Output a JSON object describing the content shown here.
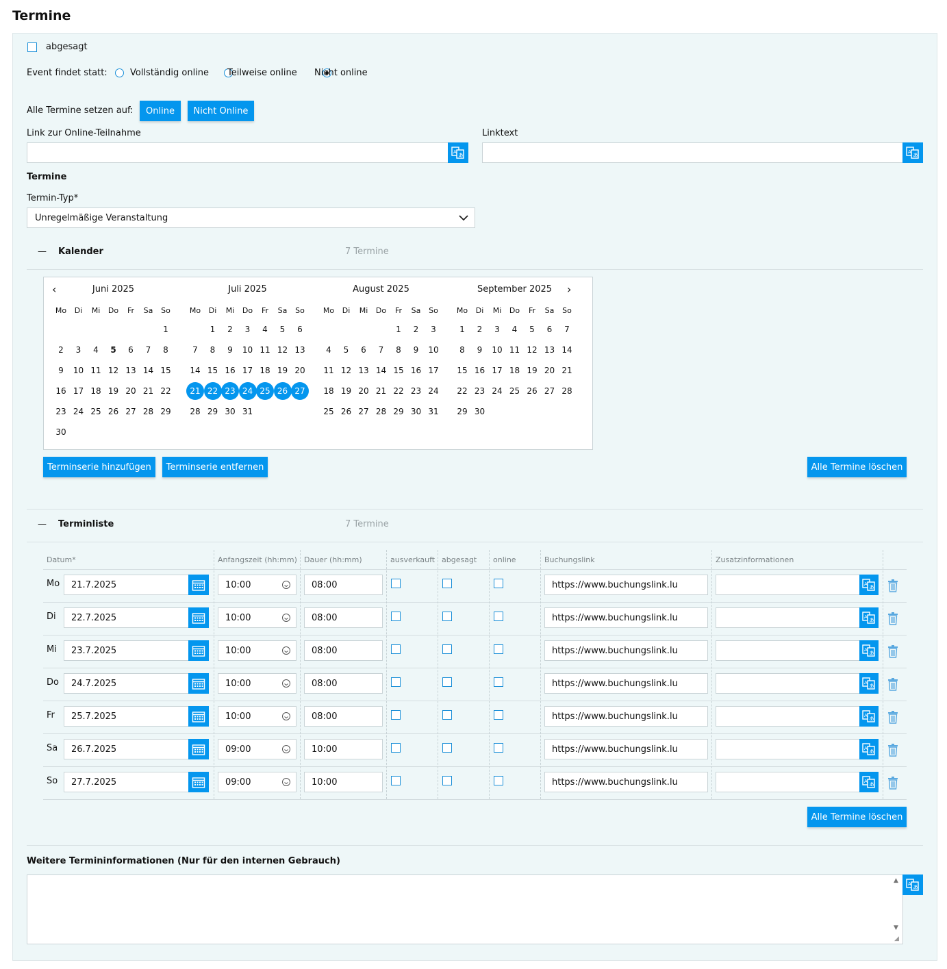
{
  "page": {
    "title": "Termine"
  },
  "cancelled": {
    "label": "abgesagt"
  },
  "event_mode": {
    "label": "Event findet statt:",
    "options": [
      {
        "label": "Vollständig online",
        "selected": false
      },
      {
        "label": "Teilweise online",
        "selected": false
      },
      {
        "label": "Nicht online",
        "selected": true
      }
    ]
  },
  "set_all": {
    "label": "Alle Termine setzen auf:",
    "online": "Online",
    "not_online": "Nicht Online"
  },
  "online_link": {
    "label": "Link zur Online-Teilnahme",
    "value": ""
  },
  "link_text": {
    "label": "Linktext",
    "value": ""
  },
  "termine": {
    "heading": "Termine",
    "type_label": "Termin-Typ*",
    "type_value": "Unregelmäßige Veranstaltung"
  },
  "calendar_section": {
    "toggle": "—",
    "title": "Kalender",
    "count": "7 Termine",
    "weekdays": [
      "Mo",
      "Di",
      "Mi",
      "Do",
      "Fr",
      "Sa",
      "So"
    ],
    "months": [
      {
        "name": "Juni 2025",
        "start": 6,
        "days": 30
      },
      {
        "name": "Juli 2025",
        "start": 1,
        "days": 31
      },
      {
        "name": "August 2025",
        "start": 4,
        "days": 31
      },
      {
        "name": "September 2025",
        "start": 0,
        "days": 30
      }
    ],
    "selected": {
      "Juli 2025": [
        21,
        22,
        23,
        24,
        25,
        26,
        27
      ]
    },
    "today": {
      "Juni 2025": 5
    },
    "add_series": "Terminserie hinzufügen",
    "remove_series": "Terminserie entfernen",
    "delete_all": "Alle Termine löschen"
  },
  "list_section": {
    "toggle": "—",
    "title": "Terminliste",
    "count": "7 Termine",
    "headers": {
      "date": "Datum*",
      "start": "Anfangszeit (hh:mm)",
      "duration": "Dauer (hh:mm)",
      "sold_out": "ausverkauft",
      "cancelled": "abgesagt",
      "online": "online",
      "booking": "Buchungslink",
      "extra": "Zusatzinformationen"
    },
    "rows": [
      {
        "weekday": "Mo",
        "date": "21.7.2025",
        "start": "10:00",
        "duration": "08:00",
        "booking": "https://www.buchungslink.lu",
        "extra": ""
      },
      {
        "weekday": "Di",
        "date": "22.7.2025",
        "start": "10:00",
        "duration": "08:00",
        "booking": "https://www.buchungslink.lu",
        "extra": ""
      },
      {
        "weekday": "Mi",
        "date": "23.7.2025",
        "start": "10:00",
        "duration": "08:00",
        "booking": "https://www.buchungslink.lu",
        "extra": ""
      },
      {
        "weekday": "Do",
        "date": "24.7.2025",
        "start": "10:00",
        "duration": "08:00",
        "booking": "https://www.buchungslink.lu",
        "extra": ""
      },
      {
        "weekday": "Fr",
        "date": "25.7.2025",
        "start": "10:00",
        "duration": "08:00",
        "booking": "https://www.buchungslink.lu",
        "extra": ""
      },
      {
        "weekday": "Sa",
        "date": "26.7.2025",
        "start": "09:00",
        "duration": "10:00",
        "booking": "https://www.buchungslink.lu",
        "extra": ""
      },
      {
        "weekday": "So",
        "date": "27.7.2025",
        "start": "09:00",
        "duration": "10:00",
        "booking": "https://www.buchungslink.lu",
        "extra": ""
      }
    ],
    "delete_all": "Alle Termine löschen"
  },
  "internal_info": {
    "label": "Weitere Termininformationen (Nur für den internen Gebrauch)",
    "value": ""
  },
  "colors": {
    "accent": "#0496ee",
    "panel": "#eef7f8"
  }
}
